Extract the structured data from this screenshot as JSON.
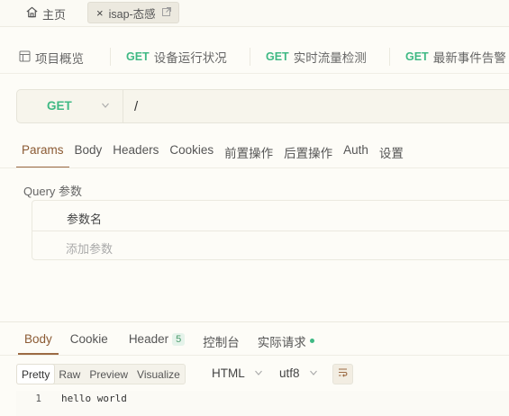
{
  "top_tabs": {
    "home_label": "主页",
    "doc_tab_label": "isap-态感",
    "close_glyph": "×"
  },
  "endpoints": {
    "overview_label": "项目概览",
    "items": [
      {
        "method": "GET",
        "name": "设备运行状况"
      },
      {
        "method": "GET",
        "name": "实时流量检测"
      },
      {
        "method": "GET",
        "name": "最新事件告警"
      }
    ]
  },
  "request": {
    "method": "GET",
    "url": "/"
  },
  "request_tabs": [
    "Params",
    "Body",
    "Headers",
    "Cookies",
    "前置操作",
    "后置操作",
    "Auth",
    "设置"
  ],
  "active_request_tab": "Params",
  "query": {
    "title": "Query 参数",
    "column_header": "参数名",
    "add_placeholder": "添加参数"
  },
  "response_tabs": {
    "body": "Body",
    "cookie": "Cookie",
    "header": "Header",
    "header_count": "5",
    "console": "控制台",
    "actual_request": "实际请求"
  },
  "view_modes": [
    "Pretty",
    "Raw",
    "Preview",
    "Visualize"
  ],
  "active_view_mode": "Pretty",
  "format": "HTML",
  "encoding": "utf8",
  "code": {
    "line_number": "1",
    "line_text": "hello world"
  },
  "colors": {
    "method_get": "#3fb984",
    "accent_brown": "#9c6b44",
    "background": "#fdfcf7"
  }
}
